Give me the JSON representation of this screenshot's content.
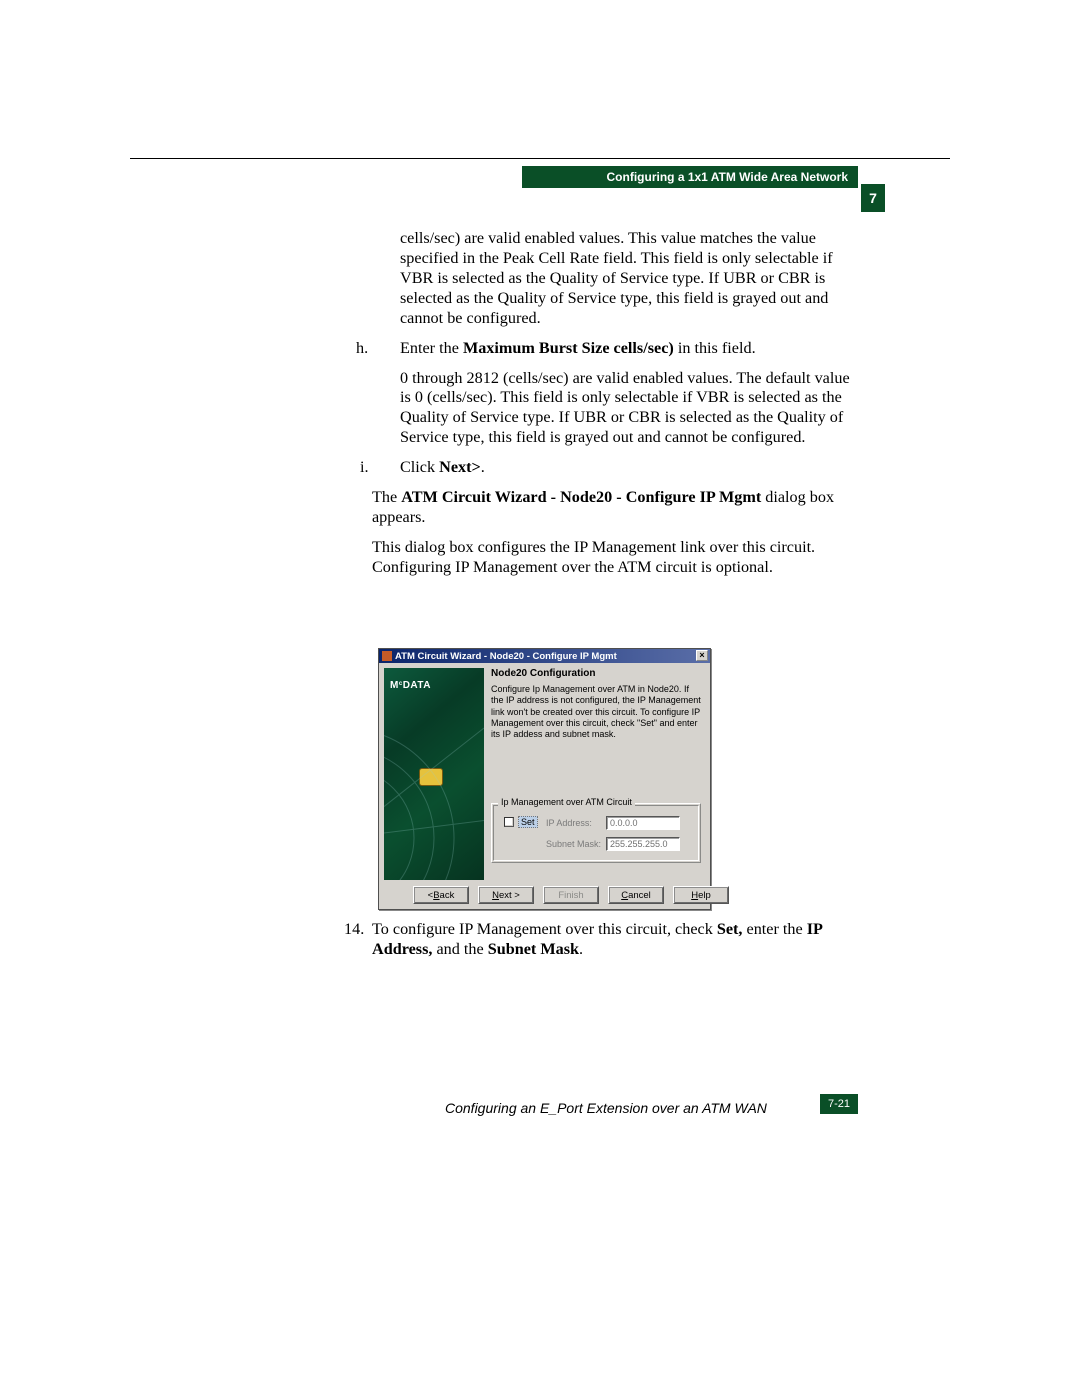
{
  "header": {
    "title": "Configuring a 1x1 ATM Wide Area Network"
  },
  "chapter_tab": "7",
  "body": {
    "para_sustain": "cells/sec) are valid enabled values. This value matches the value specified in the Peak Cell Rate field. This field is only selectable if VBR is selected as the Quality of Service type. If UBR or CBR is selected as the Quality of Service type, this field is grayed out and cannot be configured.",
    "h_marker": "h.",
    "h_lead": "Enter the ",
    "h_bold": "Maximum Burst Size cells/sec)",
    "h_tail": " in this field.",
    "h_body": "0 through 2812 (cells/sec) are valid enabled values. The default value is 0 (cells/sec). This field is only selectable if VBR is selected as the Quality of Service type. If UBR or CBR is selected as the Quality of Service type, this field is grayed out and cannot be configured.",
    "i_marker": "i.",
    "i_lead": "Click ",
    "i_bold": "Next>",
    "i_tail": ".",
    "wizard_lead": "The ",
    "wizard_bold": "ATM Circuit Wizard - Node20 - Configure IP Mgmt",
    "wizard_tail": " dialog box appears.",
    "wizard_desc": "This dialog box configures the IP Management link over this circuit. Configuring IP Management over the ATM circuit is optional.",
    "step14_marker": "14.",
    "step14_a": "To configure IP Management over this circuit, check ",
    "step14_b": "Set,",
    "step14_c": " enter the ",
    "step14_d": "IP Address,",
    "step14_e": " and the ",
    "step14_f": "Subnet Mask",
    "step14_g": "."
  },
  "dialog": {
    "title": "ATM Circuit Wizard - Node20 - Configure IP Mgmt",
    "close": "×",
    "logo": "M DATA",
    "logo_sup": "c",
    "heading": "Node20 Configuration",
    "desc": "Configure Ip Management over ATM in Node20.  If the IP address is not configured, the IP Management link won't be created over this circuit. To configure IP Management over this circuit, check \"Set\" and enter its IP addess and subnet mask.",
    "group_legend": "Ip Management over ATM  Circuit",
    "set_label": "Set",
    "ip_label": "IP Address:",
    "ip_value": "0.0.0.0",
    "mask_label": "Subnet Mask:",
    "mask_value": "255.255.255.0",
    "btn_back_pre": "< ",
    "btn_back_u": "B",
    "btn_back_post": "ack",
    "btn_next_u": "N",
    "btn_next_post": "ext >",
    "btn_finish": "Finish",
    "btn_cancel_pre": "",
    "btn_cancel_u": "C",
    "btn_cancel_post": "ancel",
    "btn_help_u": "H",
    "btn_help_post": "elp"
  },
  "footer": {
    "text": "Configuring an E_Port Extension over an ATM WAN",
    "page": "7-21"
  }
}
